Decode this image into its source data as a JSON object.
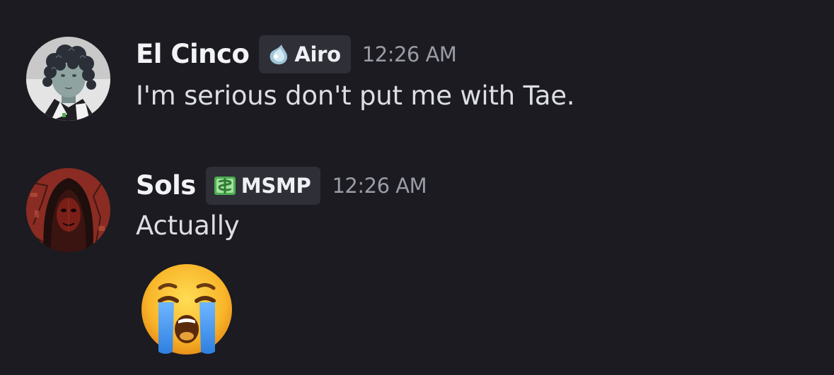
{
  "messages": [
    {
      "author": "El Cinco",
      "tag": {
        "icon": "droplet-icon",
        "label": "Airo"
      },
      "timestamp": "12:26 AM",
      "content": "I'm serious don't put me with Tae."
    },
    {
      "author": "Sols",
      "tag": {
        "icon": "dollar-bill-icon",
        "label": "MSMP"
      },
      "timestamp": "12:26 AM",
      "content": "Actually",
      "emoji": "loudly-crying-face-emoji"
    }
  ],
  "colors": {
    "background": "#1b1b21",
    "username": "#f2f3f5",
    "tag_background": "#2e2f37",
    "timestamp": "#9a9ca6",
    "message_text": "#dcdee3"
  }
}
